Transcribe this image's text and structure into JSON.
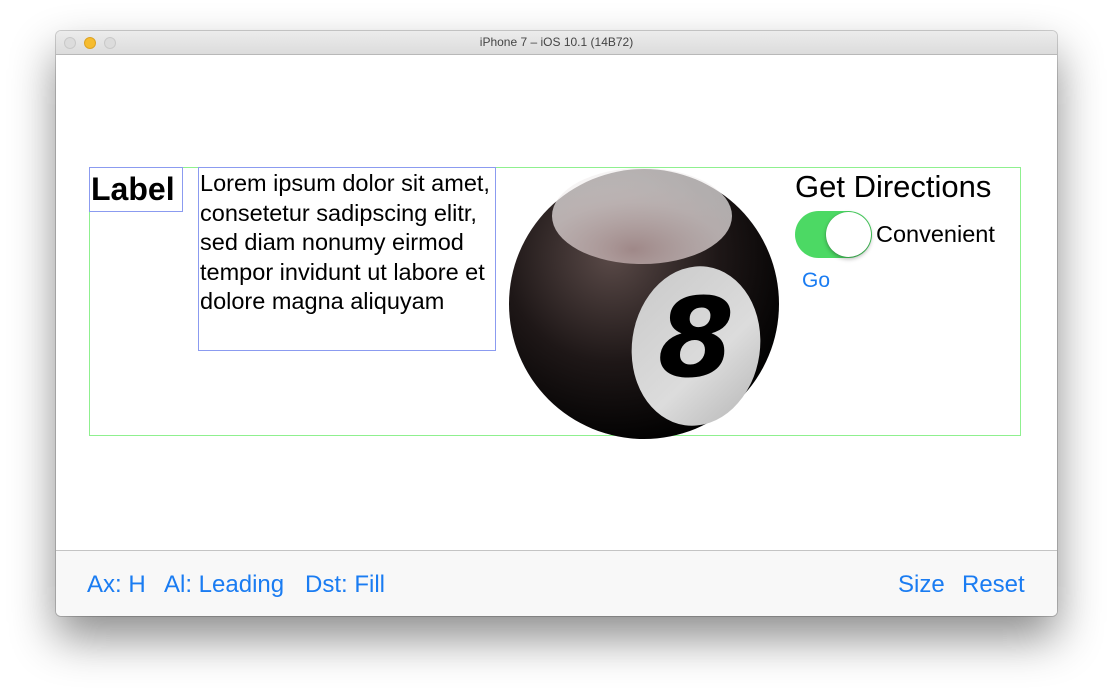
{
  "window": {
    "title": "iPhone 7 – iOS 10.1 (14B72)"
  },
  "content": {
    "label": "Label",
    "lorem": "Lorem ipsum dolor sit amet, consetetur sadipscing elitr, sed diam nonumy eirmod tempor invidunt ut labore et dolore magna aliquyam",
    "ball_number": "8",
    "directions_title": "Get Directions",
    "toggle": {
      "label": "Convenient",
      "on": true
    },
    "go_label": "Go"
  },
  "toolbar": {
    "axis": "Ax: H",
    "alignment": "Al: Leading",
    "distribution": "Dst: Fill",
    "size": "Size",
    "reset": "Reset"
  },
  "colors": {
    "accent": "#1a7cf2",
    "toggle_on": "#4cd964",
    "stack_border": "#8ff08f",
    "label_border": "#8b9bf0"
  }
}
